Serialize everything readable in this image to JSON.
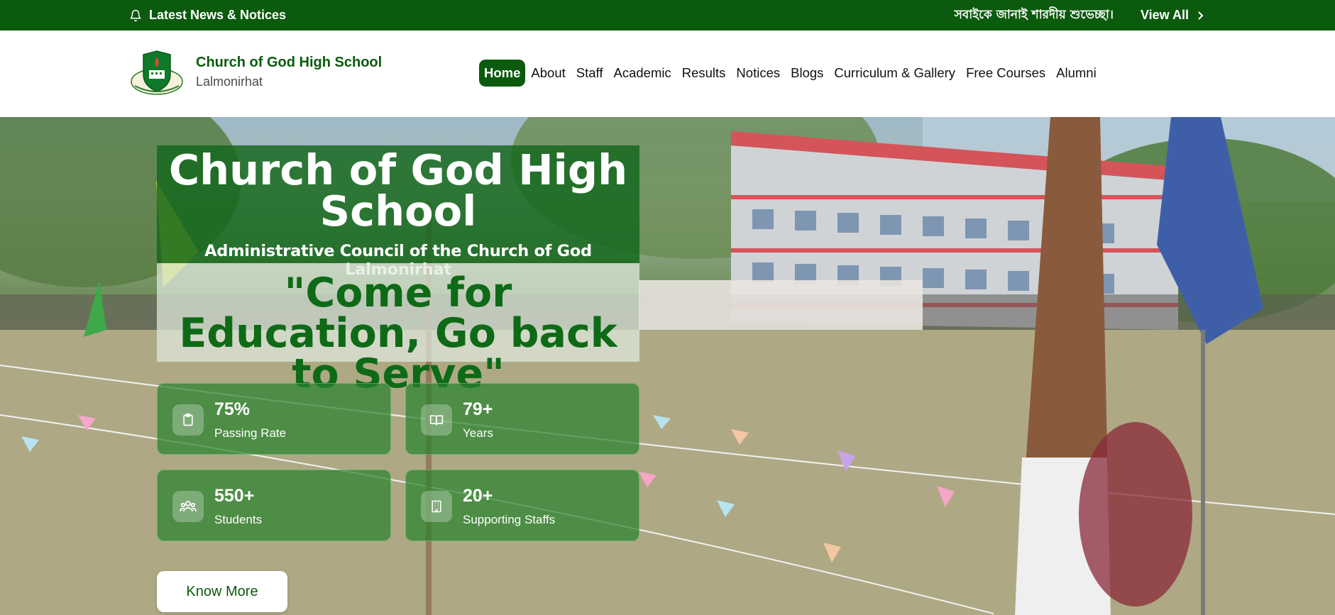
{
  "notice_bar": {
    "label": "Latest News & Notices",
    "marquee": "সবাইকে জানাই শারদীয় শুভেচ্ছা।",
    "view_all": "View All"
  },
  "brand": {
    "name": "Church of God High School",
    "location": "Lalmonirhat"
  },
  "nav": {
    "items": [
      "Home",
      "About",
      "Staff",
      "Academic",
      "Results",
      "Notices",
      "Blogs",
      "Curriculum & Gallery",
      "Free Courses",
      "Alumni"
    ],
    "active": "Home"
  },
  "hero": {
    "title": "Church of God High School",
    "subtitle": "Administrative Council of the Church of God Lalmonirhat",
    "motto": "\"Come for Education, Go back to Serve\"",
    "button": "Know More"
  },
  "stats": [
    {
      "value": "75%",
      "label": "Passing Rate",
      "icon": "clipboard-icon"
    },
    {
      "value": "79+",
      "label": "Years",
      "icon": "book-icon"
    },
    {
      "value": "550+",
      "label": "Students",
      "icon": "users-icon"
    },
    {
      "value": "20+",
      "label": "Supporting Staffs",
      "icon": "building-icon"
    }
  ],
  "colors": {
    "brand_green": "#0b5a0d",
    "accent_green": "#0e6a16"
  }
}
